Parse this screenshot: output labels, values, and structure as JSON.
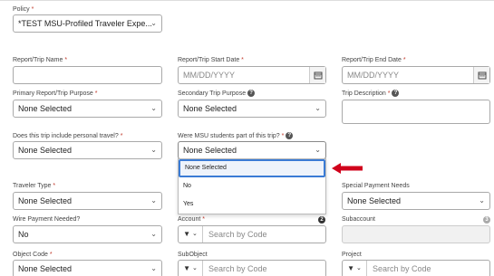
{
  "policy": {
    "label": "Policy",
    "value": "*TEST MSU-Profiled Traveler Expe..."
  },
  "report_name": {
    "label": "Report/Trip Name"
  },
  "start_date": {
    "label": "Report/Trip Start Date",
    "placeholder": "MM/DD/YYYY"
  },
  "end_date": {
    "label": "Report/Trip End Date",
    "placeholder": "MM/DD/YYYY"
  },
  "primary_purpose": {
    "label": "Primary Report/Trip Purpose",
    "value": "None Selected"
  },
  "secondary_purpose": {
    "label": "Secondary Trip Purpose",
    "value": "None Selected"
  },
  "trip_description": {
    "label": "Trip Description"
  },
  "personal_travel": {
    "label": "Does this trip include personal travel?",
    "value": "None Selected"
  },
  "msu_students": {
    "label": "Were MSU students part of this trip?",
    "value": "None Selected",
    "options": [
      "None Selected",
      "No",
      "Yes"
    ]
  },
  "traveler_type": {
    "label": "Traveler Type",
    "value": "None Selected"
  },
  "special_payment": {
    "label": "Special Payment Needs",
    "value": "None Selected"
  },
  "wire_payment": {
    "label": "Wire Payment Needed?",
    "value": "No"
  },
  "account": {
    "label": "Account",
    "placeholder": "Search by Code",
    "badge": "2"
  },
  "subaccount": {
    "label": "Subaccount",
    "badge": "3"
  },
  "object_code": {
    "label": "Object Code",
    "value": "None Selected"
  },
  "subobject": {
    "label": "SubObject",
    "placeholder": "Search by Code"
  },
  "project": {
    "label": "Project",
    "placeholder": "Search by Code"
  },
  "colors": {
    "required": "#c0392b",
    "highlight": "#3a7bd5",
    "arrow": "#d0021b"
  },
  "common": {
    "required_mark": "*",
    "help_glyph": "?",
    "chevron": "⌄",
    "filter_glyph": "▼"
  }
}
